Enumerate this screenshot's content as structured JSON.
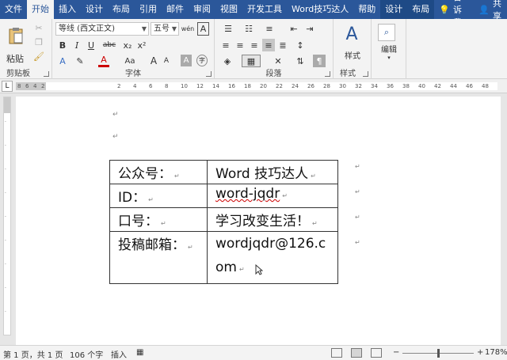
{
  "tabs": [
    "文件",
    "开始",
    "插入",
    "设计",
    "布局",
    "引用",
    "邮件",
    "审阅",
    "视图",
    "开发工具",
    "Word技巧达人",
    "帮助",
    "设计",
    "布局"
  ],
  "tell_me": "告诉我",
  "share": "共享",
  "ribbon": {
    "clipboard": {
      "label": "剪贴板",
      "paste": "粘贴"
    },
    "font": {
      "label": "字体",
      "font_name": "等线 (西文正文)",
      "font_size": "五号",
      "wen": "wén",
      "A_box": "A",
      "bold": "B",
      "italic": "I",
      "underline": "U",
      "strike": "abc",
      "sub": "x₂",
      "sup": "x²",
      "font_color": "A",
      "size_aa": "Aa",
      "grow": "A",
      "shrink": "A"
    },
    "paragraph": {
      "label": "段落"
    },
    "styles": {
      "label": "样式",
      "button": "样式"
    },
    "editing": {
      "label": "编辑"
    }
  },
  "ruler": {
    "corner": "L",
    "ticks": [
      "8",
      "6",
      "4",
      "2",
      "2",
      "4",
      "6",
      "8",
      "10",
      "12",
      "14",
      "16",
      "18",
      "20",
      "22",
      "24",
      "26",
      "28",
      "30",
      "32",
      "34",
      "36",
      "38",
      "40",
      "42",
      "44",
      "46",
      "48"
    ]
  },
  "table": {
    "rows": [
      [
        "公众号：",
        "Word 技巧达人"
      ],
      [
        "ID：",
        "word-jqdr"
      ],
      [
        "口号：",
        "学习改变生活！"
      ],
      [
        "投稿邮箱：",
        "wordjqdr@126.com"
      ]
    ]
  },
  "status": {
    "page": "第 1 页，共 1 页",
    "words": "106 个字",
    "mode": "插入",
    "zoom": "178%",
    "minus": "−",
    "plus": "+"
  },
  "marks": {
    "para": "↵"
  }
}
